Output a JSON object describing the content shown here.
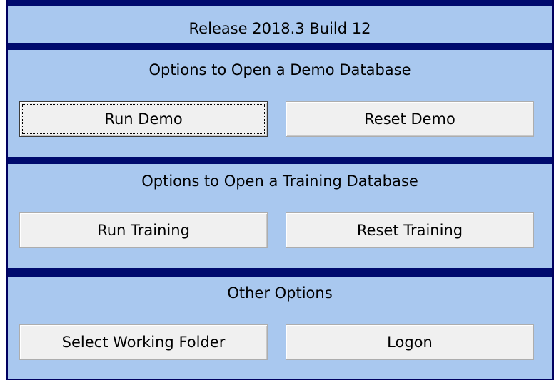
{
  "header": {
    "release_label": "Release 2018.3 Build 12"
  },
  "sections": [
    {
      "heading": "Options to Open a Demo Database",
      "buttons": [
        "Run Demo",
        "Reset Demo"
      ]
    },
    {
      "heading": "Options to Open a Training Database",
      "buttons": [
        "Run Training",
        "Reset Training"
      ]
    },
    {
      "heading": "Other Options",
      "buttons": [
        "Select Working Folder",
        "Logon"
      ]
    }
  ],
  "colors": {
    "panel_background": "#a9c8ef",
    "divider_bar": "#000b6e",
    "button_face": "#f0f0f0"
  }
}
